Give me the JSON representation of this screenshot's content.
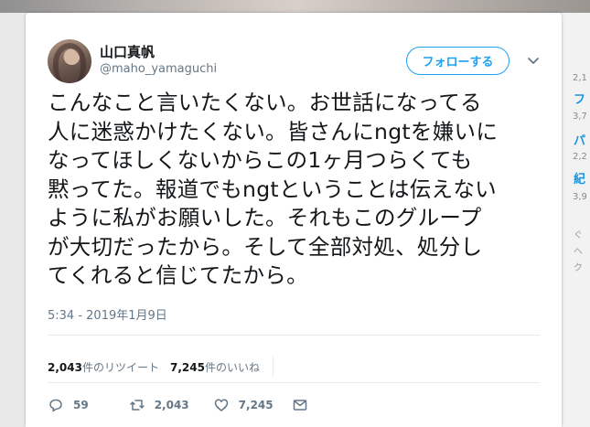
{
  "background": {
    "side_stats": [
      "2,1",
      "3,7",
      "2,2",
      "3,9"
    ],
    "side_links": [
      "フ",
      "パ",
      "紀"
    ],
    "side_small": [
      "ぐ",
      "へ",
      "ク"
    ]
  },
  "tweet": {
    "display_name": "山口真帆",
    "handle": "@maho_yamaguchi",
    "follow_label": "フォローする",
    "text": "こんなこと言いたくない。お世話になってる\n人に迷惑かけたくない。皆さんにngtを嫌いに\nなってほしくないからこの1ヶ月つらくても\n黙ってた。報道でもngtということは伝えない\nように私がお願いした。それもこのグループ\nが大切だったから。そして全部対処、処分し\nてくれると信じてたから。",
    "timestamp": "5:34 - 2019年1月9日",
    "retweet_count": "2,043",
    "retweet_label": "件のリツイート",
    "like_count": "7,245",
    "like_label": "件のいいね",
    "reply_count": "59",
    "action_retweet_count": "2,043",
    "action_like_count": "7,245"
  },
  "colors": {
    "accent": "#1da1f2",
    "text": "#14171a",
    "muted": "#657786"
  }
}
